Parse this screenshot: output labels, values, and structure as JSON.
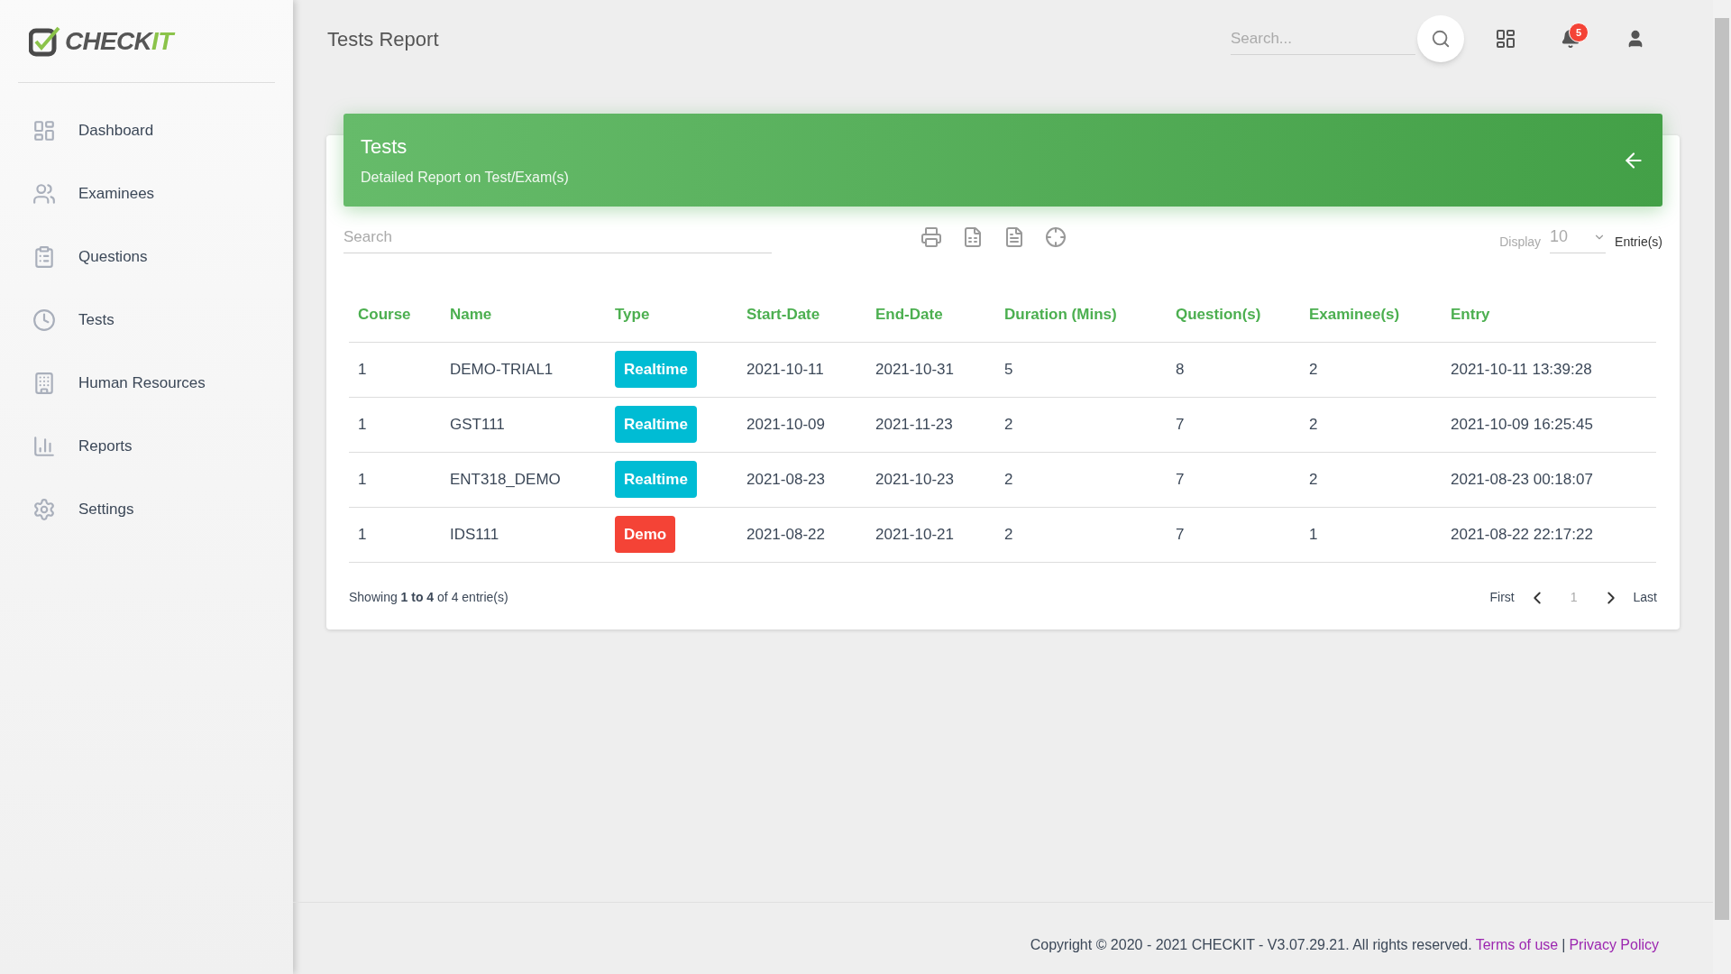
{
  "logo": {
    "text": "CHECK",
    "accent": "IT"
  },
  "sidebar": {
    "items": [
      {
        "label": "Dashboard",
        "kind": "dashboard"
      },
      {
        "label": "Examinees",
        "kind": "people"
      },
      {
        "label": "Questions",
        "kind": "clipboard"
      },
      {
        "label": "Tests",
        "kind": "clock"
      },
      {
        "label": "Human Resources",
        "kind": "building"
      },
      {
        "label": "Reports",
        "kind": "chart"
      },
      {
        "label": "Settings",
        "kind": "gear"
      }
    ]
  },
  "header": {
    "title": "Tests Report",
    "search": {
      "placeholder": "Search..."
    },
    "notifications": "5"
  },
  "card": {
    "title": "Tests",
    "subtitle": "Detailed Report on Test/Exam(s)",
    "search": {
      "placeholder": "Search"
    },
    "display_label": "Display",
    "display_value": "10",
    "entries_label": "Entrie(s)"
  },
  "table": {
    "columns": [
      "Course",
      "Name",
      "Type",
      "Start-Date",
      "End-Date",
      "Duration (Mins)",
      "Question(s)",
      "Examinee(s)",
      "Entry"
    ],
    "rows": [
      {
        "course": "1",
        "name": "DEMO-TRIAL1",
        "type": {
          "label": "Realtime",
          "kind": "realtime"
        },
        "start": "2021-10-11",
        "end": "2021-10-31",
        "duration": "5",
        "questions": "8",
        "examinees": "2",
        "entry": "2021-10-11 13:39:28"
      },
      {
        "course": "1",
        "name": "GST111",
        "type": {
          "label": "Realtime",
          "kind": "realtime"
        },
        "start": "2021-10-09",
        "end": "2021-11-23",
        "duration": "2",
        "questions": "7",
        "examinees": "2",
        "entry": "2021-10-09 16:25:45"
      },
      {
        "course": "1",
        "name": "ENT318_DEMO",
        "type": {
          "label": "Realtime",
          "kind": "realtime"
        },
        "start": "2021-08-23",
        "end": "2021-10-23",
        "duration": "2",
        "questions": "7",
        "examinees": "2",
        "entry": "2021-08-23 00:18:07"
      },
      {
        "course": "1",
        "name": "IDS111",
        "type": {
          "label": "Demo",
          "kind": "demo"
        },
        "start": "2021-08-22",
        "end": "2021-10-21",
        "duration": "2",
        "questions": "7",
        "examinees": "1",
        "entry": "2021-08-22 22:17:22"
      }
    ]
  },
  "summary": "Showing **1 to 4** of 4 entrie(s)",
  "pagination": {
    "first": "First",
    "page": "1",
    "last": "Last"
  },
  "footer": {
    "copyright": "Copyright © 2020 - 2021 CHECKIT - V3.07.29.21. All rights reserved.",
    "terms": "Terms of use",
    "separator": "|",
    "privacy": "Privacy Policy"
  }
}
